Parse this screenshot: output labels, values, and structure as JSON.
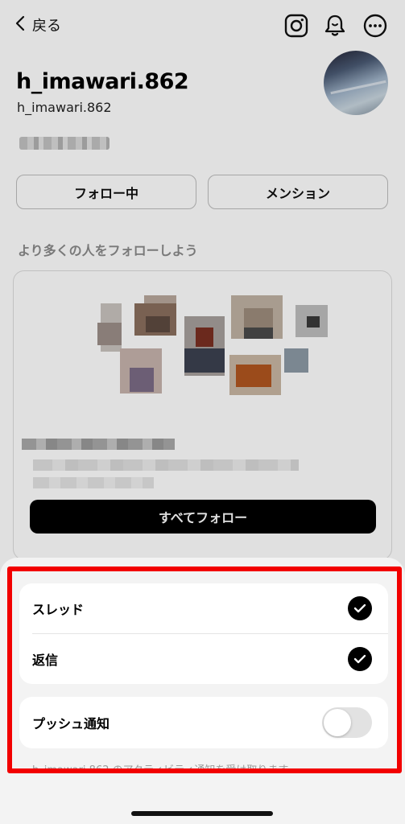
{
  "nav": {
    "back_label": "戻る",
    "icons": [
      "instagram-icon",
      "bell-icon",
      "more-icon"
    ]
  },
  "profile": {
    "name": "h_imawari.862",
    "handle": "h_imawari.862",
    "follow_button": "フォロー中",
    "mention_button": "メンション"
  },
  "suggestions": {
    "title": "より多くの人をフォローしよう",
    "follow_all_button": "すべてフォロー"
  },
  "sheet": {
    "items": [
      {
        "label": "スレッド",
        "checked": true
      },
      {
        "label": "返信",
        "checked": true
      }
    ],
    "push": {
      "label": "プッシュ通知",
      "enabled": false
    },
    "note": "h_imawari.862 のアクティビティ通知を受け取ります"
  },
  "colors": {
    "highlight": "#f20000",
    "check": "#000000",
    "sheet_bg": "#f3f3f3"
  }
}
